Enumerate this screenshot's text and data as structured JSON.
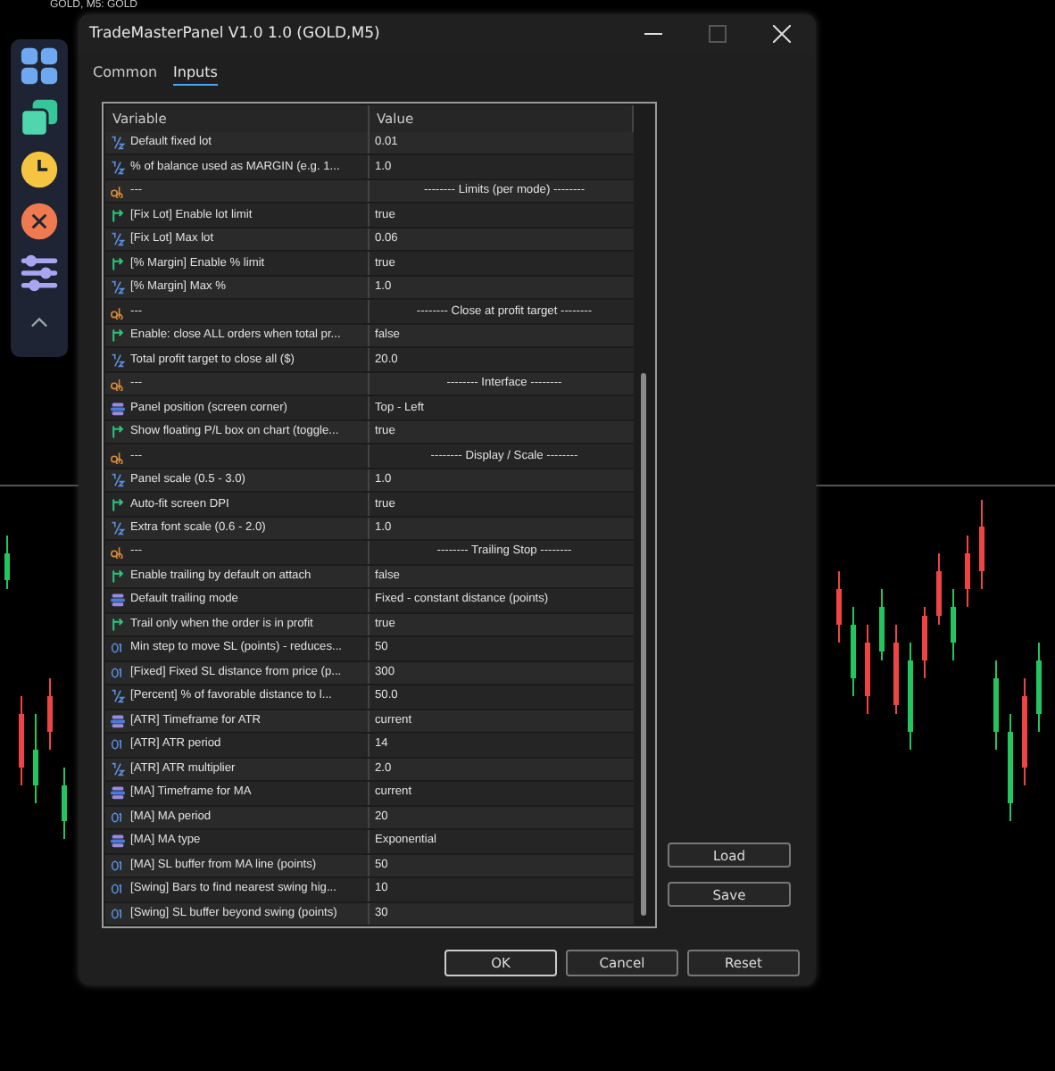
{
  "chart": {
    "title": "GOLD, M5: GOLD"
  },
  "window": {
    "title": "TradeMasterPanel V1.0 1.0 (GOLD,M5)"
  },
  "tabs": [
    {
      "label": "Common",
      "selected": false
    },
    {
      "label": "Inputs",
      "selected": true
    }
  ],
  "table": {
    "columns": [
      "Variable",
      "Value"
    ],
    "rows": [
      {
        "kind": "double",
        "variable": "Default fixed lot",
        "value": "0.01"
      },
      {
        "kind": "double",
        "variable": "% of balance used as MARGIN (e.g. 1...",
        "value": "1.0"
      },
      {
        "kind": "string",
        "variable": "---",
        "value": "-------- Limits (per mode) --------"
      },
      {
        "kind": "bool",
        "variable": "[Fix Lot] Enable lot limit",
        "value": "true"
      },
      {
        "kind": "double",
        "variable": "[Fix Lot] Max lot",
        "value": "0.06"
      },
      {
        "kind": "bool",
        "variable": "[% Margin] Enable % limit",
        "value": "true"
      },
      {
        "kind": "double",
        "variable": "[% Margin] Max %",
        "value": "1.0"
      },
      {
        "kind": "string",
        "variable": "---",
        "value": "-------- Close at profit target --------"
      },
      {
        "kind": "bool",
        "variable": "Enable: close ALL orders when total pr...",
        "value": "false"
      },
      {
        "kind": "double",
        "variable": "Total profit target to close all ($)",
        "value": "20.0"
      },
      {
        "kind": "string",
        "variable": "---",
        "value": "-------- Interface --------"
      },
      {
        "kind": "enum",
        "variable": "Panel position (screen corner)",
        "value": "Top - Left"
      },
      {
        "kind": "bool",
        "variable": "Show floating P/L box on chart (toggle...",
        "value": "true"
      },
      {
        "kind": "string",
        "variable": "---",
        "value": "-------- Display / Scale --------"
      },
      {
        "kind": "double",
        "variable": "Panel scale (0.5 - 3.0)",
        "value": "1.0"
      },
      {
        "kind": "bool",
        "variable": "Auto-fit screen DPI",
        "value": "true"
      },
      {
        "kind": "double",
        "variable": "Extra font scale (0.6 - 2.0)",
        "value": "1.0"
      },
      {
        "kind": "string",
        "variable": "---",
        "value": "-------- Trailing Stop --------"
      },
      {
        "kind": "bool",
        "variable": "Enable trailing by default on attach",
        "value": "false"
      },
      {
        "kind": "enum",
        "variable": "Default trailing mode",
        "value": "Fixed - constant distance (points)"
      },
      {
        "kind": "bool",
        "variable": "Trail only when the order is in profit",
        "value": "true"
      },
      {
        "kind": "int",
        "variable": "Min step to move SL (points) - reduces...",
        "value": "50"
      },
      {
        "kind": "int",
        "variable": "[Fixed] Fixed SL distance from price (p...",
        "value": "300"
      },
      {
        "kind": "double",
        "variable": "[Percent] % of favorable distance to l...",
        "value": "50.0"
      },
      {
        "kind": "enum",
        "variable": "[ATR] Timeframe for ATR",
        "value": "current"
      },
      {
        "kind": "int",
        "variable": "[ATR] ATR period",
        "value": "14"
      },
      {
        "kind": "double",
        "variable": "[ATR] ATR multiplier",
        "value": "2.0"
      },
      {
        "kind": "enum",
        "variable": "[MA] Timeframe for MA",
        "value": "current"
      },
      {
        "kind": "int",
        "variable": "[MA] MA period",
        "value": "20"
      },
      {
        "kind": "enum",
        "variable": "[MA] MA type",
        "value": "Exponential"
      },
      {
        "kind": "int",
        "variable": "[MA] SL buffer from MA line (points)",
        "value": "50"
      },
      {
        "kind": "int",
        "variable": "[Swing] Bars to find nearest swing hig...",
        "value": "10"
      },
      {
        "kind": "int",
        "variable": "[Swing] SL buffer beyond swing (points)",
        "value": "30"
      }
    ]
  },
  "side_buttons": [
    "Load",
    "Save"
  ],
  "buttons": [
    "OK",
    "Cancel",
    "Reset"
  ]
}
